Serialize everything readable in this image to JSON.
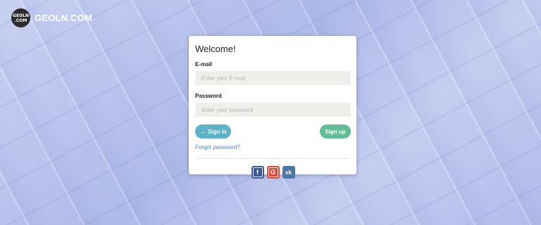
{
  "brand": {
    "badge_top": "GEOLN",
    "badge_bottom": ".COM",
    "name": "GEOLN.COM"
  },
  "login": {
    "title": "Welcome!",
    "email_label": "E-mail",
    "email_placeholder": "Enter your E-mail",
    "password_label": "Password",
    "password_placeholder": "Enter your password",
    "signin_label": "Sign in",
    "signup_label": "Sign up",
    "forgot_label": "Forgot password?"
  },
  "social": [
    {
      "name": "facebook",
      "glyph": "f",
      "color": "#3b5998"
    },
    {
      "name": "google",
      "glyph": "G",
      "color": "#dd4b39"
    },
    {
      "name": "vk",
      "glyph": "vk",
      "color": "#4a76a8"
    }
  ]
}
